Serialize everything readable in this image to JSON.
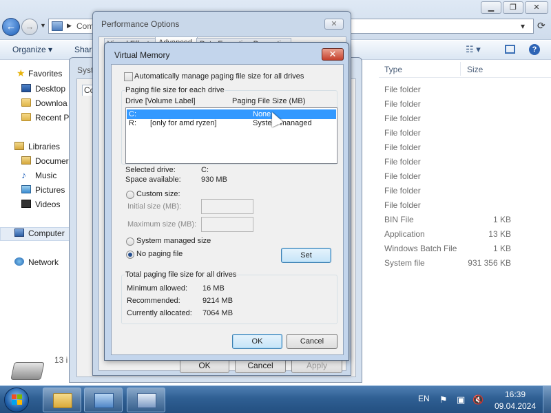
{
  "explorer": {
    "address_text": "Com",
    "toolbar": {
      "organize": "Organize ▾",
      "share": "Shar"
    },
    "nav": {
      "favorites": "Favorites",
      "desktop": "Desktop",
      "downloads": "Downloa",
      "recent": "Recent Pl",
      "libraries": "Libraries",
      "documents": "Documer",
      "music": "Music",
      "pictures": "Pictures",
      "videos": "Videos",
      "computer": "Computer",
      "network": "Network"
    },
    "columns": {
      "type": "Type",
      "size": "Size"
    },
    "files": [
      {
        "type": "File folder",
        "size": ""
      },
      {
        "type": "File folder",
        "size": ""
      },
      {
        "type": "File folder",
        "size": ""
      },
      {
        "type": "File folder",
        "size": ""
      },
      {
        "type": "File folder",
        "size": ""
      },
      {
        "type": "File folder",
        "size": ""
      },
      {
        "type": "File folder",
        "size": ""
      },
      {
        "type": "File folder",
        "size": ""
      },
      {
        "type": "File folder",
        "size": ""
      },
      {
        "type": "BIN File",
        "size": "1 KB"
      },
      {
        "type": "Application",
        "size": "13 KB"
      },
      {
        "type": "Windows Batch File",
        "size": "1 KB"
      },
      {
        "type": "System file",
        "size": "931 356 KB"
      }
    ],
    "status_count": "13 i"
  },
  "system_properties": {
    "title": "Syst",
    "tab_partial": "Co"
  },
  "performance_options": {
    "title": "Performance Options",
    "close": "✕",
    "tabs": [
      "Visual Effects",
      "Advanced",
      "Data Execution Prevention"
    ],
    "buttons": {
      "ok": "OK",
      "cancel": "Cancel",
      "apply": "Apply"
    }
  },
  "virtual_memory": {
    "title": "Virtual Memory",
    "close": "✕",
    "auto_manage_label": "Automatically manage paging file size for all drives",
    "auto_manage_checked": false,
    "group_label": "Paging file size for each drive",
    "col_drive": "Drive  [Volume Label]",
    "col_size": "Paging File Size (MB)",
    "drives": [
      {
        "drive": "C:",
        "label": "",
        "size": "None",
        "selected": true
      },
      {
        "drive": "R:",
        "label": "[only for amd ryzen]",
        "size": "System managed",
        "selected": false
      }
    ],
    "selected_drive_label": "Selected drive:",
    "selected_drive_value": "C:",
    "space_available_label": "Space available:",
    "space_available_value": "930 MB",
    "custom_size_label": "Custom size:",
    "initial_size_label": "Initial size (MB):",
    "maximum_size_label": "Maximum size (MB):",
    "system_managed_label": "System managed size",
    "no_paging_label": "No paging file",
    "selected_option": "no_paging",
    "set_button": "Set",
    "total_group_label": "Total paging file size for all drives",
    "minimum_allowed_label": "Minimum allowed:",
    "minimum_allowed_value": "16 MB",
    "recommended_label": "Recommended:",
    "recommended_value": "9214 MB",
    "currently_allocated_label": "Currently allocated:",
    "currently_allocated_value": "7064 MB",
    "ok_button": "OK",
    "cancel_button": "Cancel"
  },
  "taskbar": {
    "language": "EN",
    "time": "16:39",
    "date": "09.04.2024"
  },
  "colors": {
    "selection": "#3399ff",
    "taskbar": "#2f5f93",
    "close_red": "#c4402c"
  }
}
